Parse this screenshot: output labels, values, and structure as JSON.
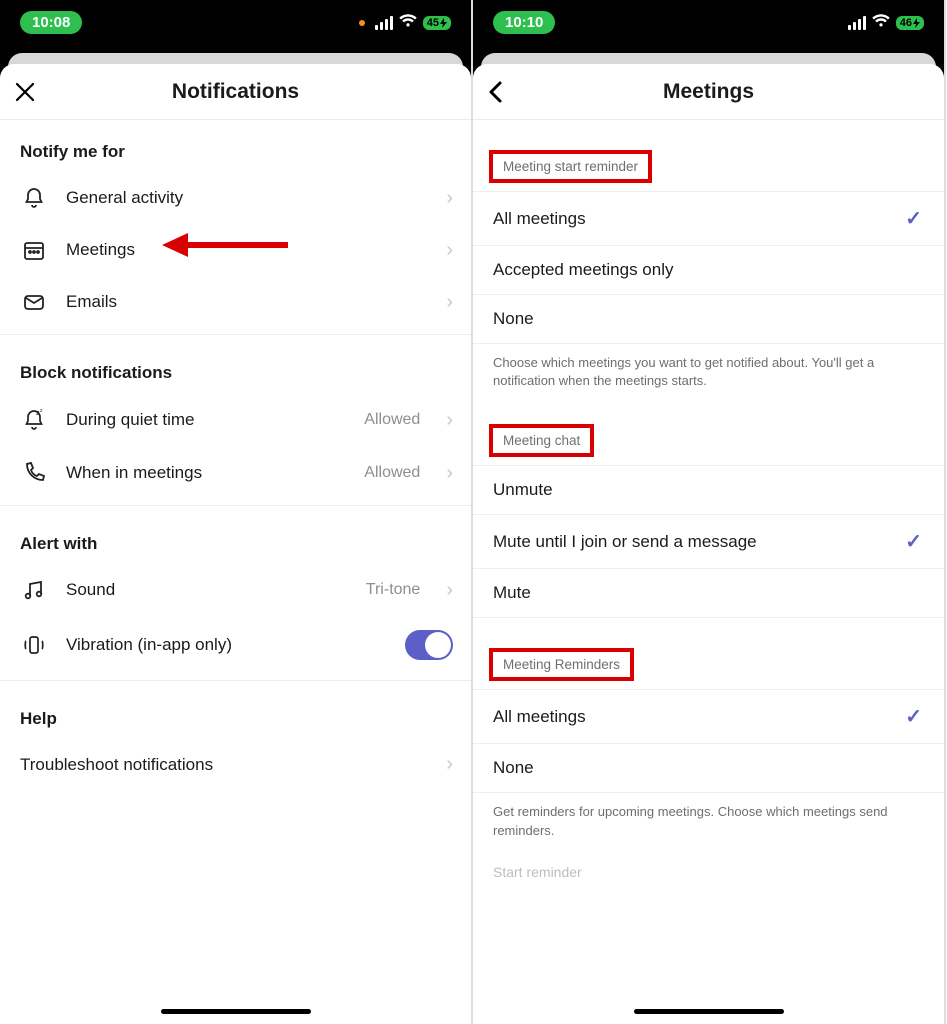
{
  "left": {
    "status": {
      "time": "10:08",
      "battery": "45"
    },
    "title": "Notifications",
    "sections": {
      "notify": {
        "header": "Notify me for",
        "items": [
          {
            "label": "General activity"
          },
          {
            "label": "Meetings"
          },
          {
            "label": "Emails"
          }
        ]
      },
      "block": {
        "header": "Block notifications",
        "items": [
          {
            "label": "During quiet time",
            "value": "Allowed"
          },
          {
            "label": "When in meetings",
            "value": "Allowed"
          }
        ]
      },
      "alert": {
        "header": "Alert with",
        "items": [
          {
            "label": "Sound",
            "value": "Tri-tone"
          },
          {
            "label": "Vibration (in-app only)"
          }
        ]
      },
      "help": {
        "header": "Help",
        "items": [
          {
            "label": "Troubleshoot notifications"
          }
        ]
      }
    }
  },
  "right": {
    "status": {
      "time": "10:10",
      "battery": "46"
    },
    "title": "Meetings",
    "groups": {
      "startReminder": {
        "label": "Meeting start reminder",
        "options": [
          {
            "label": "All meetings",
            "selected": true
          },
          {
            "label": "Accepted meetings only",
            "selected": false
          },
          {
            "label": "None",
            "selected": false
          }
        ],
        "help": "Choose which meetings you want to get notified about. You'll get a notification when the meetings starts."
      },
      "chat": {
        "label": "Meeting chat",
        "options": [
          {
            "label": "Unmute",
            "selected": false
          },
          {
            "label": "Mute until I join or send a message",
            "selected": true
          },
          {
            "label": "Mute",
            "selected": false
          }
        ]
      },
      "reminders": {
        "label": "Meeting Reminders",
        "options": [
          {
            "label": "All meetings",
            "selected": true
          },
          {
            "label": "None",
            "selected": false
          }
        ],
        "help": "Get reminders for upcoming meetings. Choose which meetings send reminders."
      },
      "cutoff": "Start reminder"
    }
  }
}
